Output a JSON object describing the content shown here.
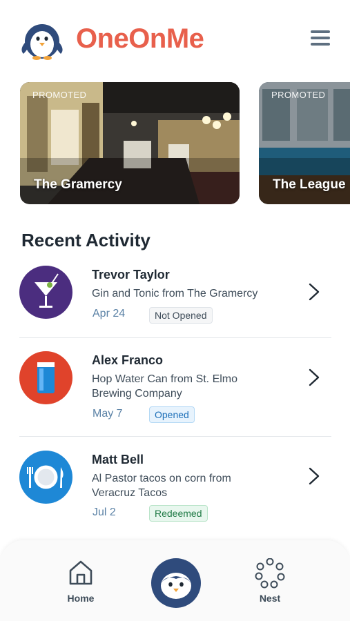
{
  "app": {
    "name": "OneOnMe"
  },
  "promos": [
    {
      "tag": "PROMOTED",
      "name": "The Gramercy"
    },
    {
      "tag": "PROMOTED",
      "name": "The League"
    }
  ],
  "recent": {
    "title": "Recent Activity",
    "items": [
      {
        "name": "Trevor Taylor",
        "desc": "Gin and Tonic from The Gramercy",
        "date": "Apr 24",
        "status": "Not Opened",
        "icon": "martini-icon",
        "color": "#4b2d7f"
      },
      {
        "name": "Alex Franco",
        "desc": "Hop Water Can from St. Elmo Brewing Company",
        "date": "May 7",
        "status": "Opened",
        "icon": "can-icon",
        "color": "#e0432b"
      },
      {
        "name": "Matt Bell",
        "desc": "Al Pastor tacos on corn from Veracruz Tacos",
        "date": "Jul 2",
        "status": "Redeemed",
        "icon": "plate-icon",
        "color": "#1e88d6"
      }
    ]
  },
  "nav": {
    "home": "Home",
    "nest": "Nest"
  },
  "colors": {
    "brand": "#e8604c",
    "navy": "#2f4b7c"
  }
}
